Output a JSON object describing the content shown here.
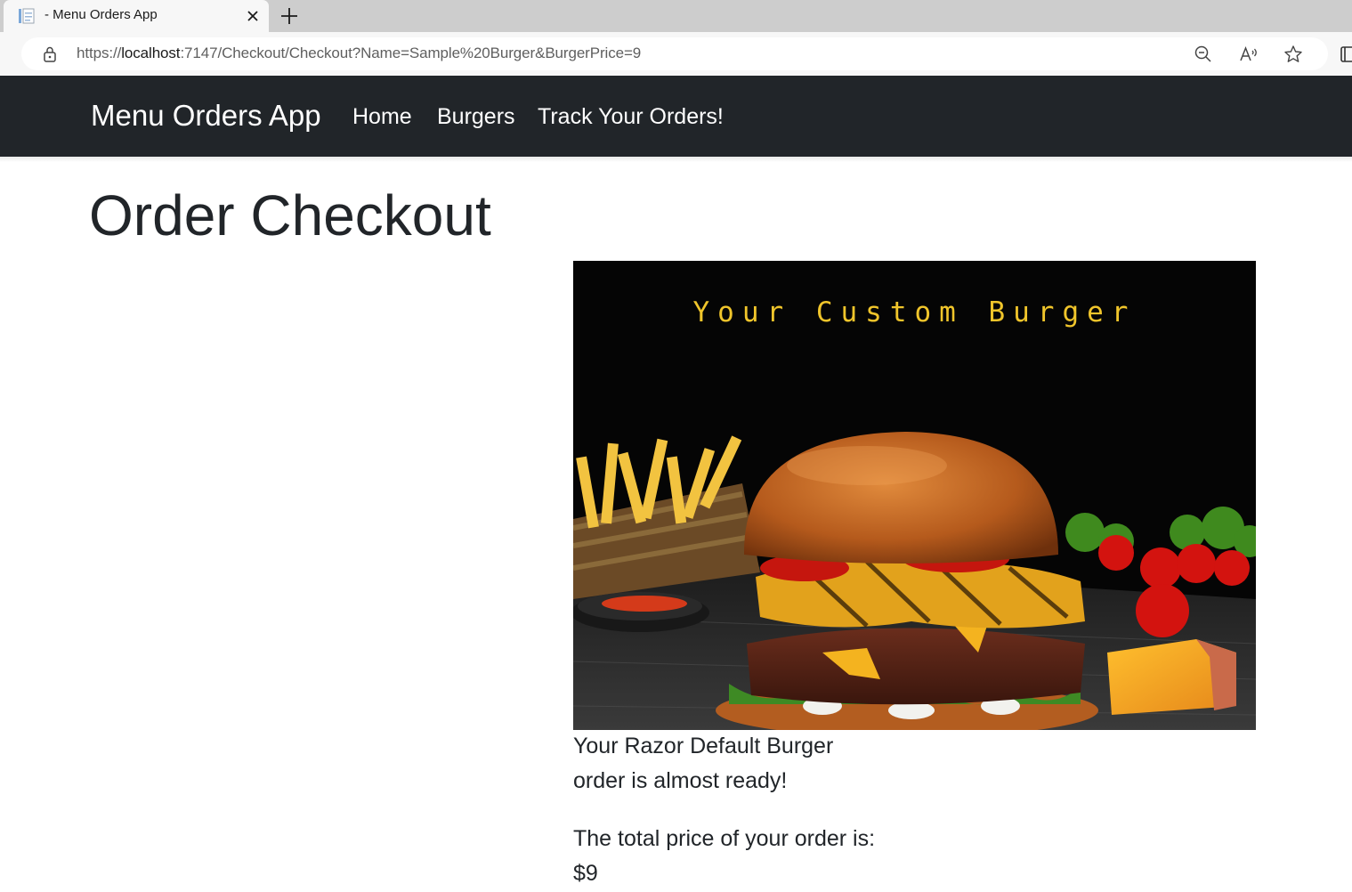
{
  "browser": {
    "tab_title": "- Menu Orders App",
    "url_prefix": "https://",
    "url_host": "localhost",
    "url_rest": ":7147/Checkout/Checkout?Name=Sample%20Burger&BurgerPrice=9"
  },
  "navbar": {
    "brand": "Menu Orders App",
    "links": [
      "Home",
      "Burgers",
      "Track Your Orders!"
    ]
  },
  "page": {
    "title": "Order Checkout",
    "image_caption": "Your Custom Burger",
    "order_line_1": "Your Razor Default Burger",
    "order_line_2": "order is almost ready!",
    "price_label": "The total price of your order is:",
    "price_value": "$9"
  },
  "colors": {
    "navbar_bg": "#212529",
    "caption_yellow": "#f0c52b",
    "text": "#212529"
  },
  "icons": [
    "page-favicon-icon",
    "close-icon",
    "plus-icon",
    "lock-icon",
    "zoom-out-icon",
    "read-aloud-icon",
    "favorite-star-icon",
    "sidebar-toggle-icon"
  ]
}
